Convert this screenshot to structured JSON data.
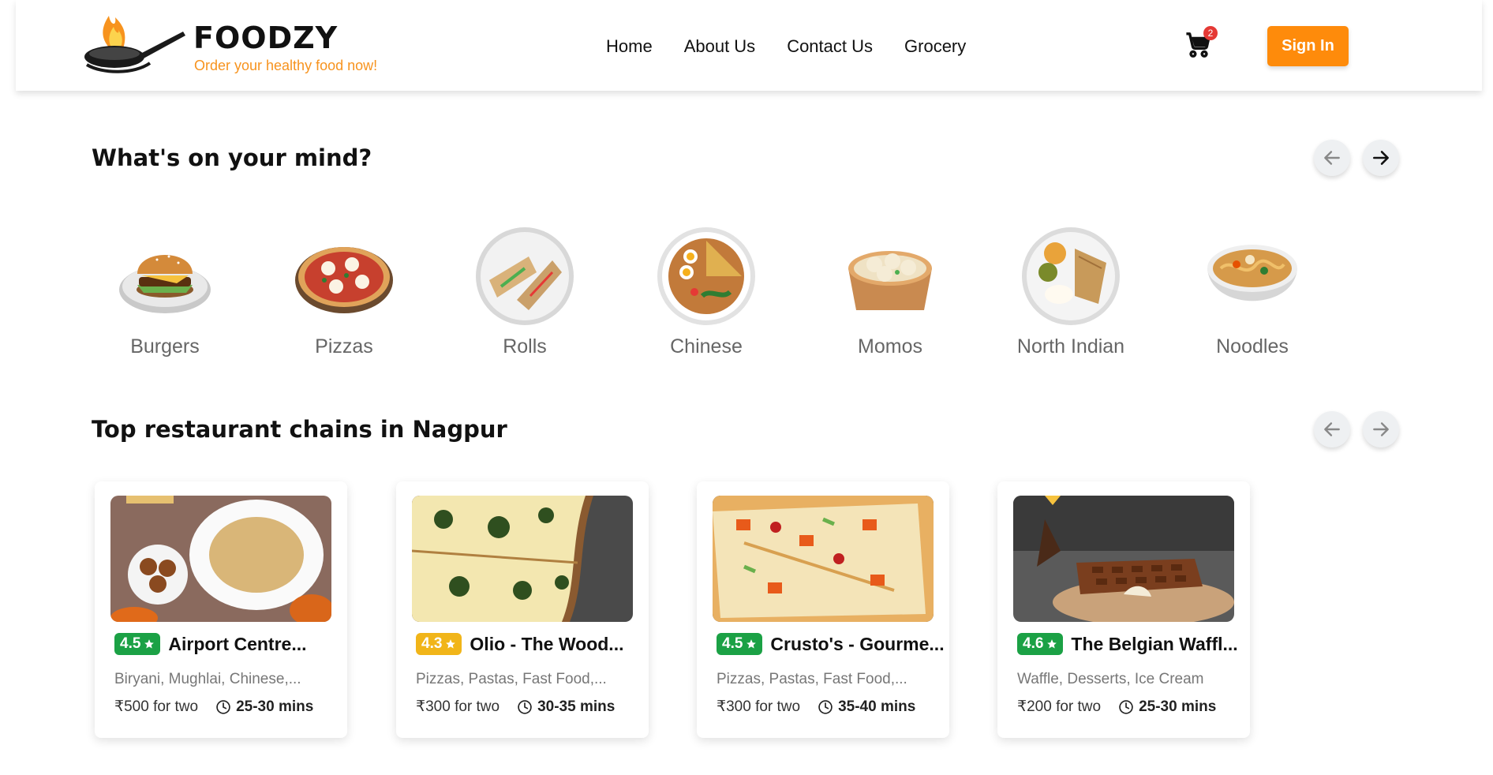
{
  "brand": {
    "name": "FOODZY",
    "tagline": "Order your healthy food now!",
    "accent": "#f7931e"
  },
  "nav": {
    "items": [
      "Home",
      "About Us",
      "Contact Us",
      "Grocery"
    ]
  },
  "cart": {
    "count": "2"
  },
  "signin": {
    "label": "Sign In",
    "color": "#fe8b0b"
  },
  "mind": {
    "title": "What's on your mind?",
    "categories": [
      {
        "label": "Burgers",
        "icon": "burger-icon"
      },
      {
        "label": "Pizzas",
        "icon": "pizza-icon"
      },
      {
        "label": "Rolls",
        "icon": "rolls-icon"
      },
      {
        "label": "Chinese",
        "icon": "chinese-icon"
      },
      {
        "label": "Momos",
        "icon": "momos-icon"
      },
      {
        "label": "North Indian",
        "icon": "thali-icon"
      },
      {
        "label": "Noodles",
        "icon": "noodles-icon"
      }
    ]
  },
  "chains": {
    "title": "Top restaurant chains in Nagpur",
    "cards": [
      {
        "rating": "4.5",
        "rating_color": "green",
        "name": "Airport Centre...",
        "cuisine": "Biryani, Mughlai, Chinese,...",
        "price": "₹500 for two",
        "time": "25-30 mins"
      },
      {
        "rating": "4.3",
        "rating_color": "amber",
        "name": "Olio - The Wood...",
        "cuisine": "Pizzas, Pastas, Fast Food,...",
        "price": "₹300 for two",
        "time": "30-35 mins"
      },
      {
        "rating": "4.5",
        "rating_color": "green",
        "name": "Crusto's - Gourme...",
        "cuisine": "Pizzas, Pastas, Fast Food,...",
        "price": "₹300 for two",
        "time": "35-40 mins"
      },
      {
        "rating": "4.6",
        "rating_color": "green",
        "name": "The Belgian Waffl...",
        "cuisine": "Waffle, Desserts, Ice Cream",
        "price": "₹200 for two",
        "time": "25-30 mins"
      }
    ]
  }
}
